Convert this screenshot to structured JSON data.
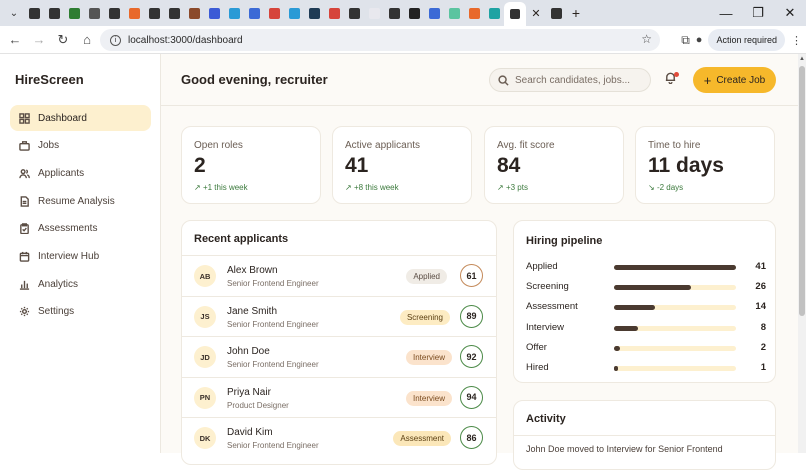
{
  "browser": {
    "url": "localhost:3000/dashboard",
    "action_required": "Action required",
    "tab_colors": [
      "#333333",
      "#333333",
      "#2e7d32",
      "#555555",
      "#333333",
      "#e8692b",
      "#333333",
      "#333333",
      "#8b4a2b",
      "#3b5bd6",
      "#2a9ad6",
      "#3b6ad6",
      "#d6443b",
      "#2a9ad6",
      "#1f3b55",
      "#d6443b",
      "#333333",
      "#e8e8ee",
      "#333333",
      "#222222",
      "#3b6ad6",
      "#5bc4a0",
      "#e8692b",
      "#1fa3a3",
      "#333333",
      "#333333"
    ]
  },
  "sidebar": {
    "brand": "HireScreen",
    "items": [
      {
        "label": "Dashboard",
        "icon": "grid-icon",
        "active": true
      },
      {
        "label": "Jobs",
        "icon": "briefcase-icon",
        "active": false
      },
      {
        "label": "Applicants",
        "icon": "users-icon",
        "active": false
      },
      {
        "label": "Resume Analysis",
        "icon": "document-icon",
        "active": false
      },
      {
        "label": "Assessments",
        "icon": "clipboard-icon",
        "active": false
      },
      {
        "label": "Interview Hub",
        "icon": "calendar-icon",
        "active": false
      },
      {
        "label": "Analytics",
        "icon": "bar-chart-icon",
        "active": false
      },
      {
        "label": "Settings",
        "icon": "gear-icon",
        "active": false
      }
    ]
  },
  "header": {
    "greeting": "Good evening, recruiter",
    "search_placeholder": "Search candidates, jobs...",
    "create_label": "Create Job"
  },
  "stats": [
    {
      "label": "Open roles",
      "value": "2",
      "delta": "+1 this week",
      "trend": "up"
    },
    {
      "label": "Active applicants",
      "value": "41",
      "delta": "+8 this week",
      "trend": "up"
    },
    {
      "label": "Avg. fit score",
      "value": "84",
      "delta": "+3 pts",
      "trend": "up"
    },
    {
      "label": "Time to hire",
      "value": "11 days",
      "delta": "-2 days",
      "trend": "down"
    }
  ],
  "recent": {
    "title": "Recent applicants",
    "rows": [
      {
        "initials": "AB",
        "name": "Alex Brown",
        "role": "Senior Frontend Engineer",
        "status": "Applied",
        "status_kind": "applied",
        "score": "61"
      },
      {
        "initials": "JS",
        "name": "Jane Smith",
        "role": "Senior Frontend Engineer",
        "status": "Screening",
        "status_kind": "screening",
        "score": "89"
      },
      {
        "initials": "JD",
        "name": "John Doe",
        "role": "Senior Frontend Engineer",
        "status": "Interview",
        "status_kind": "interview",
        "score": "92"
      },
      {
        "initials": "PN",
        "name": "Priya Nair",
        "role": "Product Designer",
        "status": "Interview",
        "status_kind": "interview",
        "score": "94"
      },
      {
        "initials": "DK",
        "name": "David Kim",
        "role": "Senior Frontend Engineer",
        "status": "Assessment",
        "status_kind": "assessment",
        "score": "86"
      }
    ]
  },
  "pipeline": {
    "title": "Hiring pipeline",
    "stages": [
      {
        "label": "Applied",
        "count": "41",
        "fraction": 1.0
      },
      {
        "label": "Screening",
        "count": "26",
        "fraction": 0.63
      },
      {
        "label": "Assessment",
        "count": "14",
        "fraction": 0.34
      },
      {
        "label": "Interview",
        "count": "8",
        "fraction": 0.2
      },
      {
        "label": "Offer",
        "count": "2",
        "fraction": 0.05
      },
      {
        "label": "Hired",
        "count": "1",
        "fraction": 0.025
      }
    ]
  },
  "activity": {
    "title": "Activity",
    "first_item": "John Doe moved to Interview for Senior Frontend"
  }
}
